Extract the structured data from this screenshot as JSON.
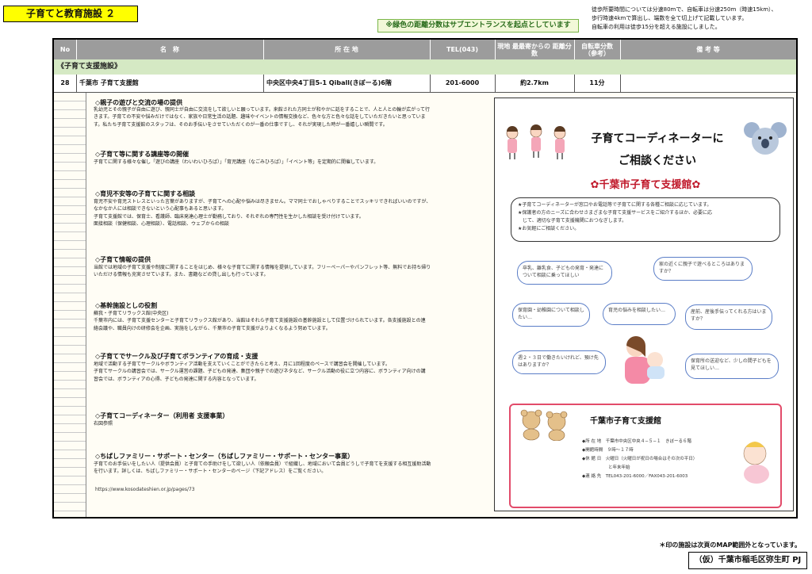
{
  "page_title": "子育てと教育施設 ２",
  "subway_note": "※緑色の距離分数はサブエントランスを起点としています",
  "top_notes": [
    "徒歩所要時間については分速80mで、自転車は分速250m（時速15km）、",
    "歩行時速4kmで算出し、端数を全て切上げて記載しています。",
    "自転車の利用は徒歩15分を超える施設にしました。"
  ],
  "table": {
    "headers": {
      "no": "No",
      "name": "名　称",
      "address": "所 在 地",
      "tel": "TEL(043)",
      "distance": "現地 最最寄からの 距離分数",
      "bicycle": "自転車分数 （参考）",
      "remarks": "備 考 等"
    },
    "category": "《子育て支援施設》",
    "row": {
      "no": "28",
      "name": "千葉市 子育て支援館",
      "address": "中央区中央4丁目5-1 Qiball(きぼーる)6階",
      "tel": "201-6000",
      "distance": "約2.7km",
      "bicycle": "11分"
    }
  },
  "sections": [
    {
      "title": "◇親子の遊びと交流の場の提供",
      "lines": [
        "乳幼児とその親子が自由に遊び、親同士が自由に交流をして欲しいと願っています。来館された方同士が和やかに話をすることで、人と人との輪が広がって行",
        "きます。子育ての不安や悩みだけではなく、家族や日常生活の話題、趣味やイベントの情報交換など、色々な方と色々な話をしていただきたいと思っていま",
        "す。私たち子育て支援館のスタッフは、そのお手伝いをさせていただくのが一番の仕事ですし、それが実現した時が一番嬉しい瞬間です。"
      ]
    },
    {
      "title": "◇子育て等に関する講座等の開催",
      "lines": [
        "子育てに関する様々な催し「遊びの講座（わいわいひろば）」「育児講座（なごみひろば）」「イベント等」を定期的に開催しています。"
      ]
    },
    {
      "title": "◇育児不安等の子育てに関する相談",
      "lines": [
        "育児不安や育児ストレスといった言葉がありますが、子育てへの心配や悩みは尽きません。ママ同士でおしゃべりすることでスッキリできればいいのですが、",
        "なかなか人には相談できないという心配事もあると思います。",
        "子育て支援館では、保育士、看護師、臨床発達心理士が勤務しており、それぞれの専門性を生かした相談を受け付けています。",
        "面接相談（保健相談、心理相談）、電話相談、ウェブからの相談"
      ]
    },
    {
      "title": "◇子育て情報の提供",
      "lines": [
        "当館では地域の子育て支援や制度に関することをはじめ、様々な子育てに関する情報を提供しています。フリーペーパーやパンフレット等、無料でお持ち帰り",
        "いただける情報も充実させています。また、書籍などの貸し出しも行っています。"
      ]
    },
    {
      "title": "◇基幹施設としの役割",
      "lines": [
        "蘇我・子育てリラックス館(中央区)",
        "千葉市内には、子育て支援センターと子育てリラックス館があり、当館はそれら子育て支援施設の基幹施設として位置づけられています。各支援施設との連",
        "絡会議や、職員向けの研修会を企画、実施をしながら、千葉市の子育て支援がよりよくなるよう努めています。"
      ]
    },
    {
      "title": "◇子育てでサークル及び子育てボランティアの育成・支援",
      "lines": [
        "地域で活動する子育てサークルやボランティア活動を支えていくことができたらと考え、月に1回程度のペースで講習会を開催しています。",
        "子育てサークルの講習会では、サークル運営の課題、子どもの発達、集団や親子での遊びネタなど、サークル活動の役に立つ内容に、ボランティア向けの講",
        "習会では、ボランティアの心得、子どもの発達に関する内容となっています。"
      ]
    },
    {
      "title": "◇子育てコーディネーター（利用者 支援事業）",
      "lines": [
        "右図参照"
      ]
    },
    {
      "title": "◇ちばしファミリー・サポート・センター（ちばしファミリー・サポート・センター事業）",
      "lines": [
        "子育てのお手伝いをしたい人（提供会員）と子育ての手助けをして欲しい人（依頼会員）で組織し、地域において会員どうしで子育てを支援する相互援助活動",
        "を行います。詳しくは、ちばしファミリー・サポート・センターのページ（下記アドレス）をご覧ください。"
      ]
    }
  ],
  "url": "https://www.kosodateshien.or.jp/pages/73",
  "poster": {
    "headline1": "子育てコーディネーターに",
    "headline2": "ご相談ください",
    "facility": "千葉市子育て支援館",
    "info_lines": [
      "★子育てコーディネーターが窓口やお電話等で子育てに関する各種ご相談に応じています。",
      "★保護者の方のニーズに合わせさまざまな子育て支援サービスをご紹介するほか、必要に応",
      "　じて、適切な子育て支援機関におつなぎします。",
      "★お気軽にご相談ください。"
    ],
    "bubbles": [
      "卒乳、離乳食、子どもの発育・発達について相談に乗ってほしい",
      "家の近くに親子で遊べるところはありますか？",
      "保育園・幼稚園について相談したい…",
      "育児の悩みを相談したい…",
      "産前、産後手伝ってくれる方はいますか？",
      "週２・３日で働きたいけれど、預け先はありますか？",
      "保育所の送迎など、少しの間子どもを見てほしい…"
    ],
    "card_title": "千葉市子育て支援館",
    "card_lines": [
      "◆所 在 地　千葉市中央区中央４−５−１　きぼーる６階",
      "◆開館時間　９時〜１７時",
      "◆休 館 日　火曜日（火曜日が祝日の場合はその次の平日）",
      "　　　　　　と年末年始",
      "◆連 絡 先　TEL043-201-6000／FAX043-201-6003"
    ]
  },
  "bottom_note": "＊印の施設は次頁のMAP範囲外となっています。",
  "credit": "（仮）千葉市稲毛区弥生町 PJ",
  "colors": {
    "title_bg": "#ffff00",
    "header_bg": "#9c9c9c",
    "category_bg": "#d5e9c4",
    "note_green": "#2a6d1c",
    "poster_heading_red": "#c0182a",
    "bubble_border": "#5b7ec7"
  }
}
